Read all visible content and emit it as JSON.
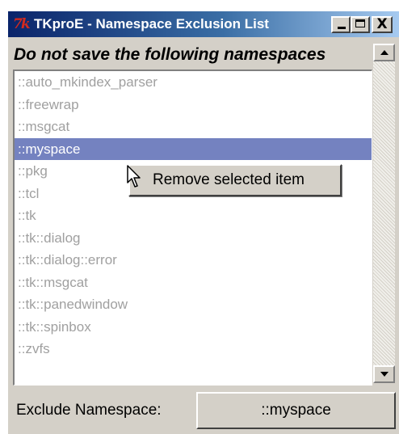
{
  "window": {
    "icon_text": "7k",
    "title": "TKproE - Namespace Exclusion List",
    "close_glyph": "X"
  },
  "header": {
    "text": "Do not save the following namespaces"
  },
  "list": {
    "items": [
      "::auto_mkindex_parser",
      "::freewrap",
      "::msgcat",
      "::myspace",
      "::pkg",
      "::tcl",
      "::tk",
      "::tk::dialog",
      "::tk::dialog::error",
      "::tk::msgcat",
      "::tk::panedwindow",
      "::tk::spinbox",
      "::zvfs"
    ],
    "selected_index": 3
  },
  "context_menu": {
    "item_label": "Remove selected item"
  },
  "footer": {
    "label": "Exclude Namespace:",
    "button_value": "::myspace"
  },
  "colors": {
    "title_bar": "#0a246a",
    "selection": "#7482c0",
    "list_text": "#a0a0a0",
    "face": "#d4d0c8"
  },
  "icons": {
    "app": "tk-feather-icon",
    "minimize": "minimize-icon",
    "maximize": "maximize-icon",
    "close": "close-icon",
    "cursor": "mouse-pointer-icon"
  }
}
